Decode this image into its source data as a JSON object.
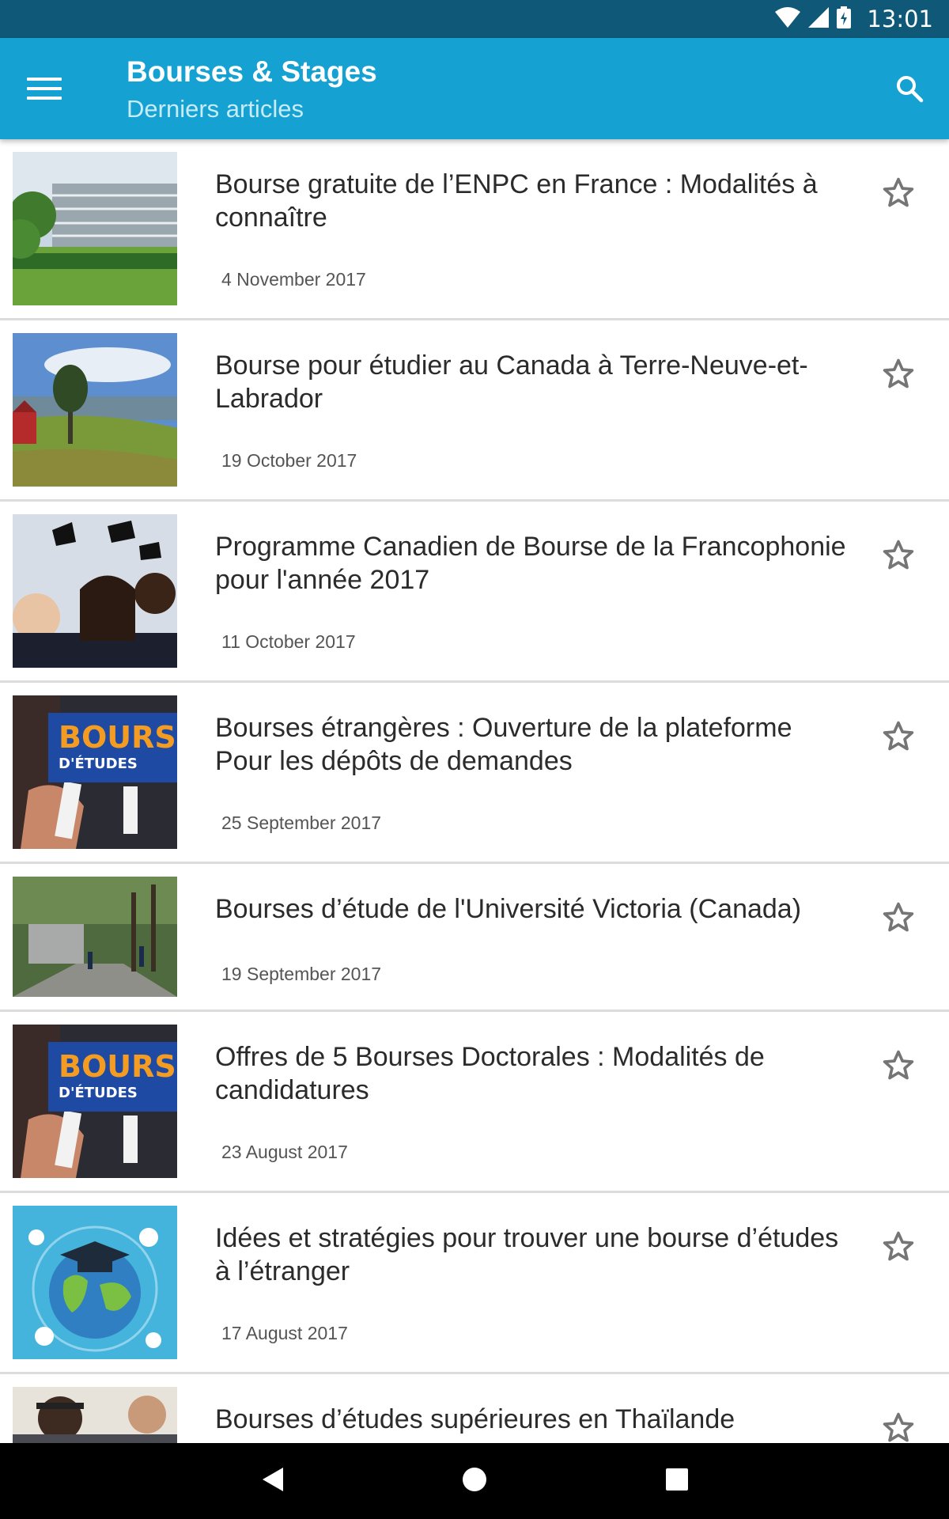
{
  "status_bar": {
    "time": "13:01"
  },
  "app_bar": {
    "title": "Bourses & Stages",
    "subtitle": "Derniers articles"
  },
  "articles": [
    {
      "title": "Bourse gratuite de l’ENPC en France : Modalités à connaître",
      "date": "4 November 2017",
      "image": "building-campus-photo"
    },
    {
      "title": "Bourse pour étudier au Canada à Terre-Neuve-et-Labrador",
      "date": "19 October 2017",
      "image": "coastal-landscape-photo"
    },
    {
      "title": "Programme Canadien de Bourse de la Francophonie pour l'année 2017",
      "date": "11 October 2017",
      "image": "graduates-celebrating-photo"
    },
    {
      "title": "Bourses étrangères : Ouverture de la plateforme Pour les dépôts de demandes",
      "date": "25 September 2017",
      "image": "bourse-d-etudes-banner",
      "banner_line1": "BOURSE",
      "banner_line2": "D'ÉTUDES"
    },
    {
      "title": "Bourses d’étude de l'Université Victoria (Canada)",
      "date": "19 September 2017",
      "image": "campus-path-photo"
    },
    {
      "title": "Offres de 5 Bourses Doctorales : Modalités de candidatures",
      "date": "23 August 2017",
      "image": "bourse-d-etudes-banner",
      "banner_line1": "BOURSE",
      "banner_line2": "D'ÉTUDES"
    },
    {
      "title": "Idées et stratégies pour trouver une bourse d’études à l’étranger",
      "date": "17 August 2017",
      "image": "globe-graduation-cap-illustration"
    },
    {
      "title": "Bourses d’études supérieures en Thaïlande",
      "date": "",
      "image": "students-photo"
    }
  ],
  "colors": {
    "status_bar": "#0f5878",
    "app_bar": "#15a1d1",
    "divider": "#dcdcdc",
    "star": "#757575"
  }
}
